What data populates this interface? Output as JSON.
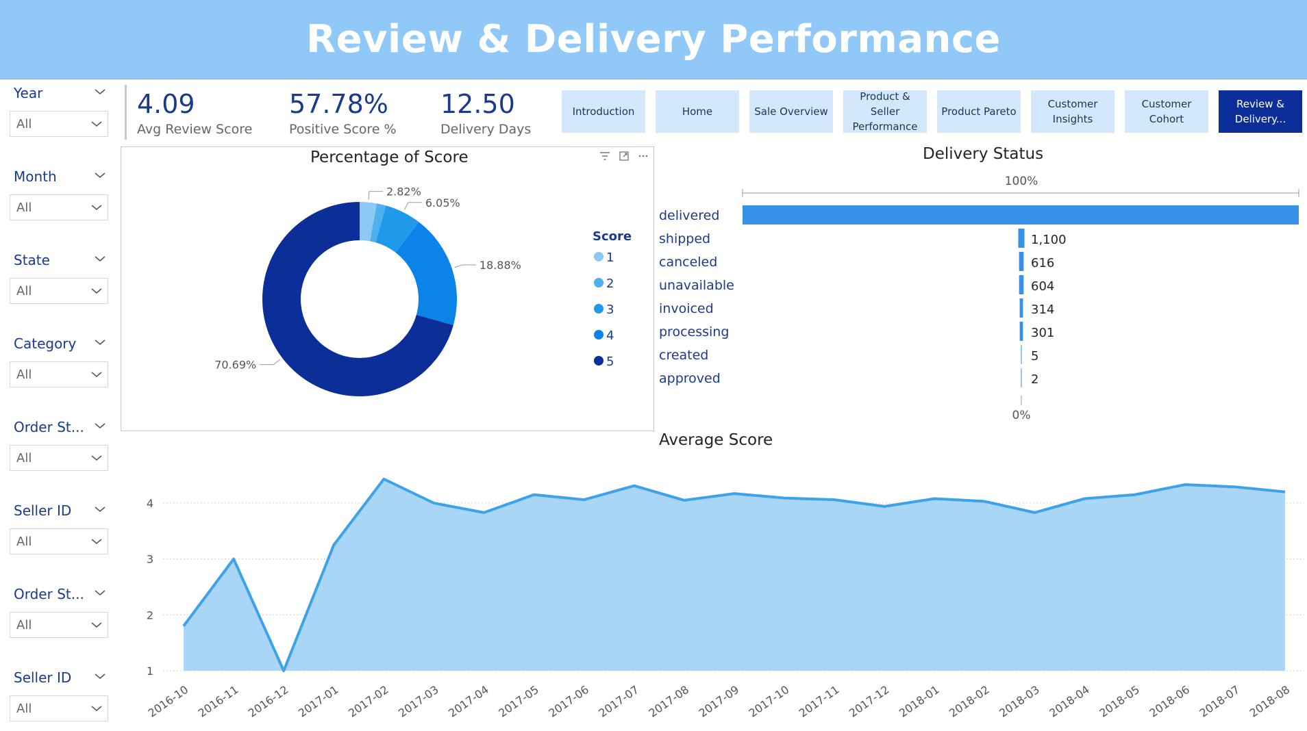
{
  "header": {
    "title": "Review & Delivery Performance"
  },
  "slicers": [
    {
      "title": "Year",
      "value": "All"
    },
    {
      "title": "Month",
      "value": "All"
    },
    {
      "title": "State",
      "value": "All"
    },
    {
      "title": "Category",
      "value": "All"
    },
    {
      "title": "Order St...",
      "value": "All"
    },
    {
      "title": "Seller ID",
      "value": "All"
    },
    {
      "title": "Order St...",
      "value": "All"
    },
    {
      "title": "Seller ID",
      "value": "All"
    }
  ],
  "kpis": [
    {
      "value": "4.09",
      "label": "Avg Review Score"
    },
    {
      "value": "57.78%",
      "label": "Positive Score %"
    },
    {
      "value": "12.50",
      "label": "Delivery Days"
    }
  ],
  "nav": [
    {
      "label": "Introduction",
      "active": false
    },
    {
      "label": "Home",
      "active": false
    },
    {
      "label": "Sale Overview",
      "active": false
    },
    {
      "label": "Product & Seller Performance",
      "active": false
    },
    {
      "label": "Product Pareto",
      "active": false
    },
    {
      "label": "Customer Insights",
      "active": false
    },
    {
      "label": "Customer Cohort",
      "active": false
    },
    {
      "label": "Review & Delivery...",
      "active": true
    }
  ],
  "colors": {
    "header": "#90c8f8",
    "accent_dark": "#1a3a8f",
    "bar": "#3591ea",
    "area_fill": "#a9d5f7",
    "area_line": "#3da2e8"
  },
  "chart_data": [
    {
      "type": "pie",
      "title": "Percentage of Score",
      "legend_title": "Score",
      "legend_position": "right",
      "categories": [
        "1",
        "2",
        "3",
        "4",
        "5"
      ],
      "values": [
        2.82,
        1.56,
        6.05,
        18.88,
        70.69
      ],
      "labels": [
        "2.82%",
        "",
        "6.05%",
        "18.88%",
        "70.69%"
      ],
      "colors": [
        "#8cc8f4",
        "#4fb0ee",
        "#1f9aea",
        "#0b84ea",
        "#0b2e99"
      ]
    },
    {
      "type": "bar",
      "title": "Delivery Status",
      "orientation": "horizontal",
      "categories": [
        "delivered",
        "shipped",
        "canceled",
        "unavailable",
        "invoiced",
        "processing",
        "created",
        "approved"
      ],
      "values": [
        96478,
        1100,
        616,
        604,
        314,
        301,
        5,
        2
      ],
      "data_labels": [
        "",
        "1,100",
        "616",
        "604",
        "314",
        "301",
        "5",
        "2"
      ],
      "axis_top_label": "100%",
      "axis_bottom_label": "0%"
    },
    {
      "type": "area",
      "title": "Average Score",
      "x": [
        "2016-10",
        "2016-11",
        "2016-12",
        "2017-01",
        "2017-02",
        "2017-03",
        "2017-04",
        "2017-05",
        "2017-06",
        "2017-07",
        "2017-08",
        "2017-09",
        "2017-10",
        "2017-11",
        "2017-12",
        "2018-01",
        "2018-02",
        "2018-03",
        "2018-04",
        "2018-05",
        "2018-06",
        "2018-07",
        "2018-08"
      ],
      "values": [
        1.8,
        3.0,
        1.0,
        3.25,
        4.43,
        4.0,
        3.83,
        4.15,
        4.06,
        4.31,
        4.05,
        4.17,
        4.09,
        4.06,
        3.94,
        4.08,
        4.03,
        3.83,
        4.08,
        4.15,
        4.33,
        4.29,
        4.2
      ],
      "yticks": [
        1,
        2,
        3,
        4
      ],
      "ylim": [
        1,
        4.6
      ],
      "grid": true
    }
  ]
}
